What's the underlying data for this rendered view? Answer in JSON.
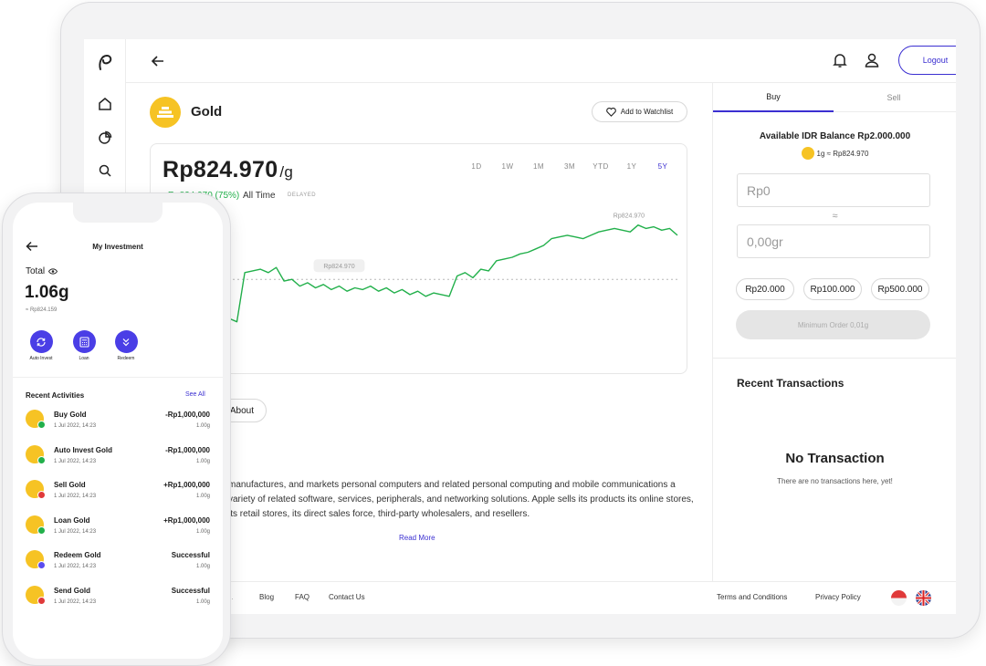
{
  "tablet": {
    "back_icon": "arrow-left-icon",
    "logout_label": "Logout",
    "asset": {
      "name": "Gold",
      "watchlist_label": "Add to Watchlist"
    },
    "chart_header": {
      "price": "Rp824.970",
      "unit": "/g",
      "change": "+Rp824.970 (75%)",
      "period": "All Time",
      "delayed": "DELAYED",
      "ranges": [
        "1D",
        "1W",
        "1M",
        "3M",
        "YTD",
        "1Y",
        "5Y"
      ],
      "active_range": "5Y"
    },
    "about_label": "About",
    "description": "manufactures, and markets personal computers and related personal computing and mobile communications a variety of related software, services, peripherals, and networking solutions. Apple sells its products its online stores, its retail stores, its direct sales force, third-party wholesalers, and resellers.",
    "read_more": "Read More",
    "trade": {
      "tabs": [
        "Buy",
        "Sell"
      ],
      "active_tab": "Buy",
      "balance": "Available IDR Balance Rp2.000.000",
      "rate": "1g ≈ Rp824.970",
      "amount_placeholder": "Rp0",
      "approx_symbol": "≈",
      "gram_placeholder": "0,00gr",
      "presets": [
        "Rp20.000",
        "Rp100.000",
        "Rp500.000"
      ],
      "min_order": "Minimum Order 0,01g"
    },
    "recent": {
      "title": "Recent Transactions",
      "empty_title": "No Transaction",
      "empty_sub": "There are no transactions here, yet!"
    },
    "footer": {
      "partial": "d.",
      "links": [
        "Blog",
        "FAQ",
        "Contact Us"
      ],
      "right_links": [
        "Terms and Conditions",
        "Privacy Policy"
      ]
    }
  },
  "chart_data": {
    "type": "line",
    "title": "",
    "xlabel": "",
    "ylabel": "",
    "color": "#22b04b",
    "reference_label": "Rp824.970",
    "peak_label": "Rp824.970",
    "x": [
      0,
      1,
      2,
      3,
      4,
      5,
      6,
      7,
      8,
      9,
      10,
      11,
      12,
      13,
      14,
      15,
      16,
      17,
      18,
      19,
      20,
      21,
      22,
      23,
      24,
      25,
      26,
      27,
      28,
      29,
      30,
      31,
      32,
      33,
      34,
      35,
      36,
      37,
      38,
      39,
      40,
      41,
      42,
      43,
      44,
      45,
      46,
      47,
      48,
      49,
      50,
      51,
      52,
      53,
      54,
      55,
      56,
      57,
      58,
      59,
      60
    ],
    "values": [
      60,
      62,
      58,
      61,
      59,
      88,
      89,
      90,
      88,
      91,
      83,
      84,
      80,
      82,
      79,
      81,
      78,
      80,
      77,
      79,
      78,
      80,
      77,
      79,
      76,
      78,
      75,
      77,
      74,
      76,
      75,
      74,
      86,
      88,
      85,
      90,
      89,
      95,
      96,
      97,
      99,
      100,
      102,
      104,
      108,
      109,
      110,
      109,
      108,
      110,
      112,
      113,
      114,
      113,
      112,
      116,
      114,
      115,
      113,
      114,
      110
    ],
    "ylim": [
      40,
      125
    ],
    "reference_value": 84
  },
  "phone": {
    "title": "My Investment",
    "total_label": "Total",
    "total_amount": "1.06g",
    "total_approx": "≈ Rp824.159",
    "actions": [
      {
        "label": "Auto Invest",
        "icon": "refresh-icon"
      },
      {
        "label": "Loan",
        "icon": "calculator-icon"
      },
      {
        "label": "Redeem",
        "icon": "chevrons-down-icon"
      }
    ],
    "recent_title": "Recent Activities",
    "see_all": "See All",
    "activities": [
      {
        "name": "Buy Gold",
        "date": "1 Jul 2022, 14:23",
        "value": "-Rp1,000,000",
        "amount": "1.00g",
        "badge": "#22b04b"
      },
      {
        "name": "Auto Invest Gold",
        "date": "1 Jul 2022, 14:23",
        "value": "-Rp1,000,000",
        "amount": "1.00g",
        "badge": "#22b04b"
      },
      {
        "name": "Sell Gold",
        "date": "1 Jul 2022, 14:23",
        "value": "+Rp1,000,000",
        "amount": "1.00g",
        "badge": "#e03a3a"
      },
      {
        "name": "Loan Gold",
        "date": "1 Jul 2022, 14:23",
        "value": "+Rp1,000,000",
        "amount": "1.00g",
        "badge": "#22b04b"
      },
      {
        "name": "Redeem Gold",
        "date": "1 Jul 2022, 14:23",
        "value": "Successful",
        "amount": "1.00g",
        "badge": "#5a4cf0"
      },
      {
        "name": "Send Gold",
        "date": "1 Jul 2022, 14:23",
        "value": "Successful",
        "amount": "1.00g",
        "badge": "#e03a3a"
      }
    ]
  }
}
